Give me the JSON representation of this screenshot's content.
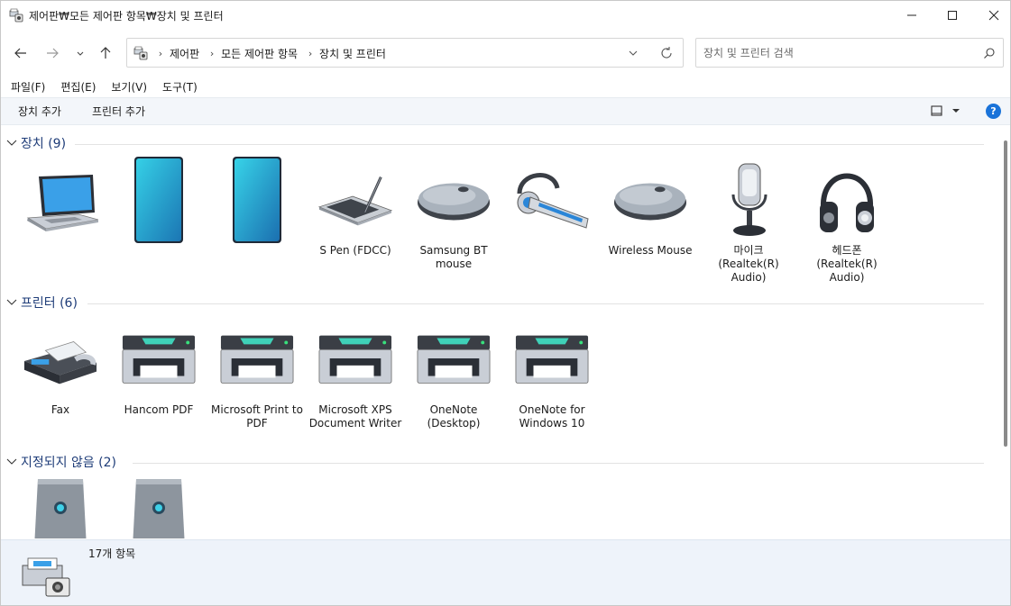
{
  "window": {
    "title": "제어판₩모든 제어판 항목₩장치 및 프린터"
  },
  "address": {
    "crumbs": [
      "제어판",
      "모든 제어판 항목",
      "장치 및 프린터"
    ]
  },
  "search": {
    "placeholder": "장치 및 프린터 검색"
  },
  "menu": {
    "items": [
      "파일(F)",
      "편집(E)",
      "보기(V)",
      "도구(T)"
    ]
  },
  "commands": {
    "add_device": "장치 추가",
    "add_printer": "프린터 추가",
    "help": "?"
  },
  "groups": {
    "devices": {
      "title": "장치 (9)",
      "items": [
        {
          "label": "",
          "icon": "laptop-icon"
        },
        {
          "label": "",
          "icon": "phone-icon"
        },
        {
          "label": "",
          "icon": "phone-icon"
        },
        {
          "label": "S Pen (FDCC)",
          "icon": "pen-tablet-icon"
        },
        {
          "label": "Samsung BT mouse",
          "icon": "mouse-icon"
        },
        {
          "label": "",
          "icon": "headset-icon"
        },
        {
          "label": "Wireless Mouse",
          "icon": "mouse-icon"
        },
        {
          "label": "마이크 (Realtek(R) Audio)",
          "icon": "microphone-icon"
        },
        {
          "label": "헤드폰 (Realtek(R) Audio)",
          "icon": "headphones-icon"
        }
      ]
    },
    "printers": {
      "title": "프린터 (6)",
      "items": [
        {
          "label": "Fax",
          "icon": "fax-icon"
        },
        {
          "label": "Hancom PDF",
          "icon": "printer-icon"
        },
        {
          "label": "Microsoft Print to PDF",
          "icon": "printer-icon"
        },
        {
          "label": "Microsoft XPS Document Writer",
          "icon": "printer-icon"
        },
        {
          "label": "OneNote (Desktop)",
          "icon": "printer-icon"
        },
        {
          "label": "OneNote for Windows 10",
          "icon": "printer-icon"
        }
      ]
    },
    "unspecified": {
      "title": "지정되지 않음 (2)",
      "items": [
        {
          "label": "",
          "icon": "drive-box-icon"
        },
        {
          "label": "",
          "icon": "drive-box-icon"
        }
      ]
    }
  },
  "status": {
    "count": "17개 항목"
  },
  "colors": {
    "group_title": "#1e3c78",
    "command_bar": "#f3f6fa",
    "details_pane": "#eef3fa",
    "help_blue": "#1a73d9",
    "phone_teal": "#22b5d6"
  }
}
